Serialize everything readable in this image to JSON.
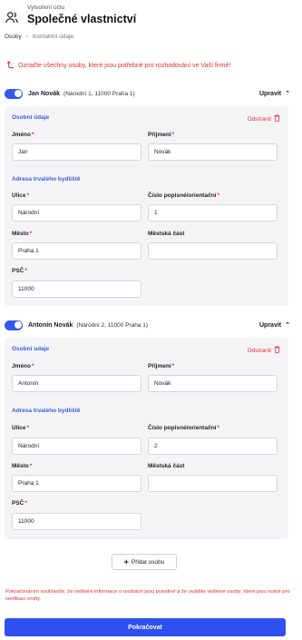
{
  "header": {
    "subtitle": "Vytvoření účtu",
    "title": "Společné vlastnictví",
    "icon": "people-icon"
  },
  "breadcrumb": {
    "items": [
      "Osoby",
      "Kontaktní údaje"
    ],
    "separator": "›"
  },
  "notice": {
    "text": "Označte všechny osoby, které jsou potřebné pro rozhodování ve Vaší firmě!",
    "icon": "arrow-turn-icon"
  },
  "persons": [
    {
      "name": "Jan Novák",
      "address": "(Národní 1, 11000 Praha 1)",
      "enabled": true,
      "edit_label": "Upravit",
      "personal_section": "Osobní údaje",
      "remove_label": "Odstranit",
      "first_name_label": "Jméno",
      "first_name": "Jan",
      "last_name_label": "Příjmení",
      "last_name": "Novák",
      "address_section": "Adresa trvalého bydliště",
      "street_label": "Ulice",
      "street": "Národní",
      "number_label": "Číslo popisné/orientační",
      "number": "1",
      "city_label": "Město",
      "city": "Praha 1",
      "district_label": "Městská část",
      "district": "",
      "zip_label": "PSČ",
      "zip": "11000"
    },
    {
      "name": "Antonín Novák",
      "address": "(Národní 2, 11000 Praha 1)",
      "enabled": true,
      "edit_label": "Upravit",
      "personal_section": "Osobní údaje",
      "remove_label": "Odstranit",
      "first_name_label": "Jméno",
      "first_name": "Antonín",
      "last_name_label": "Příjmení",
      "last_name": "Novák",
      "address_section": "Adresa trvalého bydliště",
      "street_label": "Ulice",
      "street": "Národní",
      "number_label": "Číslo popisné/orientační",
      "number": "2",
      "city_label": "Město",
      "city": "Praha 1",
      "district_label": "Městská část",
      "district": "",
      "zip_label": "PSČ",
      "zip": "11000"
    }
  ],
  "add_person_label": "Přidat osobu",
  "consent_text": "Pokračováním souhlasíte, že veškeré informace o osobách jsou pravdivé a že uvádíte veškeré osoby, které jsou nutné pro verifikaci entity.",
  "continue_label": "Pokračovat",
  "colors": {
    "accent": "#2f4ff0",
    "danger": "#e03030",
    "section": "#3c5ed8"
  }
}
